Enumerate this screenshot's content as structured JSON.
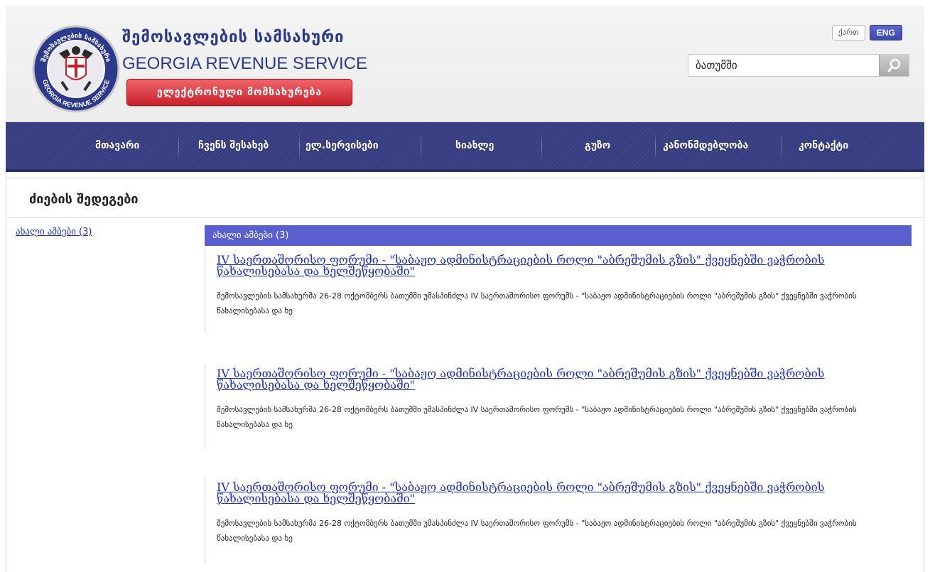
{
  "header": {
    "brand_ka": "შემოსავლების სამსახური",
    "brand_en": "GEORGIA REVENUE SERVICE",
    "eservice_button": "ელექტრონული მომსახურება",
    "logo_text_ka": "შემოსავლების სამსახური",
    "logo_text_en": "GEORGIA REVENUE SERVICE",
    "lang_ka": "ქართ",
    "lang_en": "ENG",
    "search_value": "ბათუმში",
    "accent_color": "#3d48a9",
    "button_color": "#c7202a"
  },
  "nav": {
    "items": [
      {
        "label": "მთავარი"
      },
      {
        "label": "ჩვენს შესახებ"
      },
      {
        "label": "ელ.სერვისები"
      },
      {
        "label": "სიახლე"
      },
      {
        "label": "გუზო"
      },
      {
        "label": "კანონმდებლობა"
      },
      {
        "label": "კონტაქტი"
      }
    ],
    "background_color": "#3e4488"
  },
  "main": {
    "title": "ძიების შედეგები",
    "sidebar_link": "ახალი ამბები (3)",
    "category_label": "ახალი ამბები (3)",
    "category_color": "#5a5fcf",
    "results": [
      {
        "title": "IV საერთაშორისო ფორუმი - \"საბაჟო ადმინისტრაციების როლი \"აბრეშუმის გზის\" ქვეყნებში ვაჭრობის წახალისებასა და ხელშეწყობაში\"",
        "snippet": "შემოსავლების  სამსახურმა 26-28 ოქტომბერს ბათუმში უმასპინძლა IV საერთაშორისო ფორუმს - \"საბაჟო ადმინისტრაციების როლი \"აბრეშუმის გზის\" ქვეყნებში ვაჭრობის წახალისებასა და ხე"
      },
      {
        "title": "IV საერთაშორისო ფორუმი - \"საბაჟო ადმინისტრაციების როლი \"აბრეშუმის გზის\" ქვეყნებში ვაჭრობის წახალისებასა და ხელშეწყობაში\"",
        "snippet": "შემოსავლების  სამსახურმა 26-28 ოქტომბერს ბათუმში უმასპინძლა IV საერთაშორისო ფორუმს - \"საბაჟო ადმინისტრაციების როლი \"აბრეშუმის გზის\" ქვეყნებში ვაჭრობის წახალისებასა და ხე"
      },
      {
        "title": "IV საერთაშორისო ფორუმი - \"საბაჟო ადმინისტრაციების როლი \"აბრეშუმის გზის\" ქვეყნებში ვაჭრობის წახალისებასა და ხელშეწყობაში\"",
        "snippet": "შემოსავლების  სამსახურმა 26-28 ოქტომბერს ბათუმში უმასპინძლა IV საერთაშორისო ფორუმს - \"საბაჟო ადმინისტრაციების როლი \"აბრეშუმის გზის\" ქვეყნებში ვაჭრობის წახალისებასა და ხე"
      }
    ]
  },
  "icons": {
    "logo": "revenue-service-emblem",
    "search": "magnifier-icon"
  }
}
